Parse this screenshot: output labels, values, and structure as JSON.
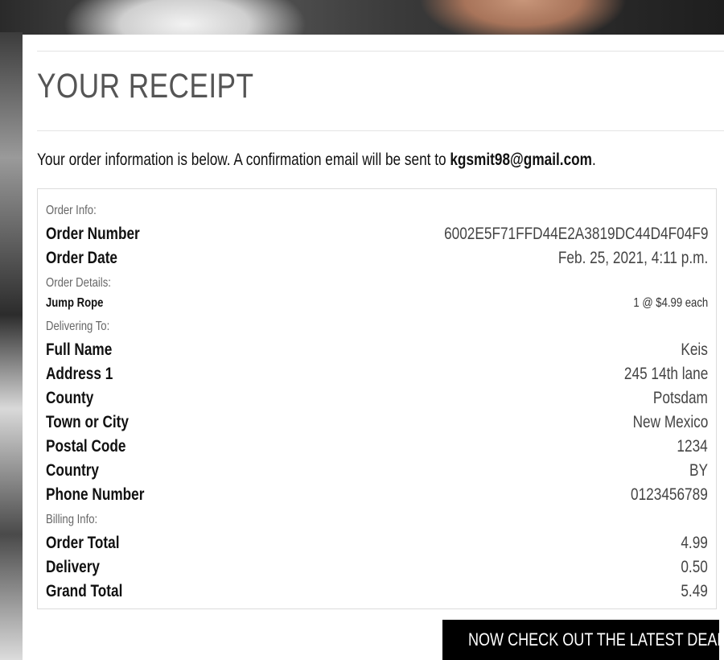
{
  "page": {
    "title": "YOUR RECEIPT",
    "intro_prefix": "Your order information is below. A confirmation email will be sent to ",
    "email": "kgsmit98@gmail.com",
    "intro_suffix": "."
  },
  "receipt": {
    "order_info_heading": "Order Info:",
    "order_number_label": "Order Number",
    "order_number_value": "6002E5F71FFD44E2A3819DC44D4F04F9",
    "order_date_label": "Order Date",
    "order_date_value": "Feb. 25, 2021, 4:11 p.m.",
    "order_details_heading": "Order Details:",
    "item_name": "Jump Rope",
    "item_qty_price": "1 @ $4.99 each",
    "delivering_heading": "Delivering To:",
    "full_name_label": "Full Name",
    "full_name_value": "Keis",
    "address1_label": "Address 1",
    "address1_value": "245 14th lane",
    "county_label": "County",
    "county_value": "Potsdam",
    "town_label": "Town or City",
    "town_value": "New Mexico",
    "postal_label": "Postal Code",
    "postal_value": "1234",
    "country_label": "Country",
    "country_value": "BY",
    "phone_label": "Phone Number",
    "phone_value": "0123456789",
    "billing_heading": "Billing Info:",
    "order_total_label": "Order Total",
    "order_total_value": "4.99",
    "delivery_label": "Delivery",
    "delivery_value": "0.50",
    "grand_total_label": "Grand Total",
    "grand_total_value": "5.49"
  },
  "cta": {
    "label": "NOW CHECK OUT THE LATEST DEALS!",
    "icon": "gifts-icon"
  }
}
